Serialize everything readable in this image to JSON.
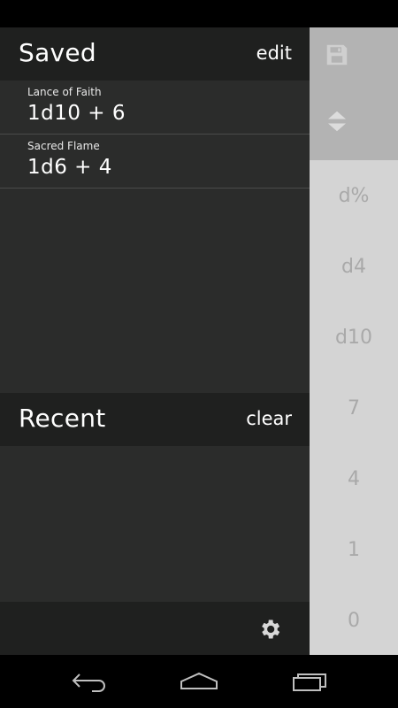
{
  "saved": {
    "title": "Saved",
    "action_label": "edit",
    "items": [
      {
        "name": "Lance of Faith",
        "formula": "1d10 + 6"
      },
      {
        "name": "Sacred Flame",
        "formula": "1d6 + 4"
      }
    ]
  },
  "recent": {
    "title": "Recent",
    "action_label": "clear"
  },
  "keypad": {
    "keys": [
      "d%",
      "d4",
      "d10",
      "7",
      "4",
      "1",
      "0"
    ]
  },
  "icons": {
    "save": "save-icon",
    "toggle": "expand-collapse-icon",
    "settings": "gear-icon",
    "back": "back-icon",
    "home": "home-icon",
    "recents": "recent-apps-icon"
  },
  "colors": {
    "drawer_bg": "#2b2c2b",
    "header_bg": "#1f201f",
    "keypad_bg": "#d4d4d4",
    "keypad_top_bg": "#b3b3b3",
    "key_text": "#a9a9a9"
  }
}
